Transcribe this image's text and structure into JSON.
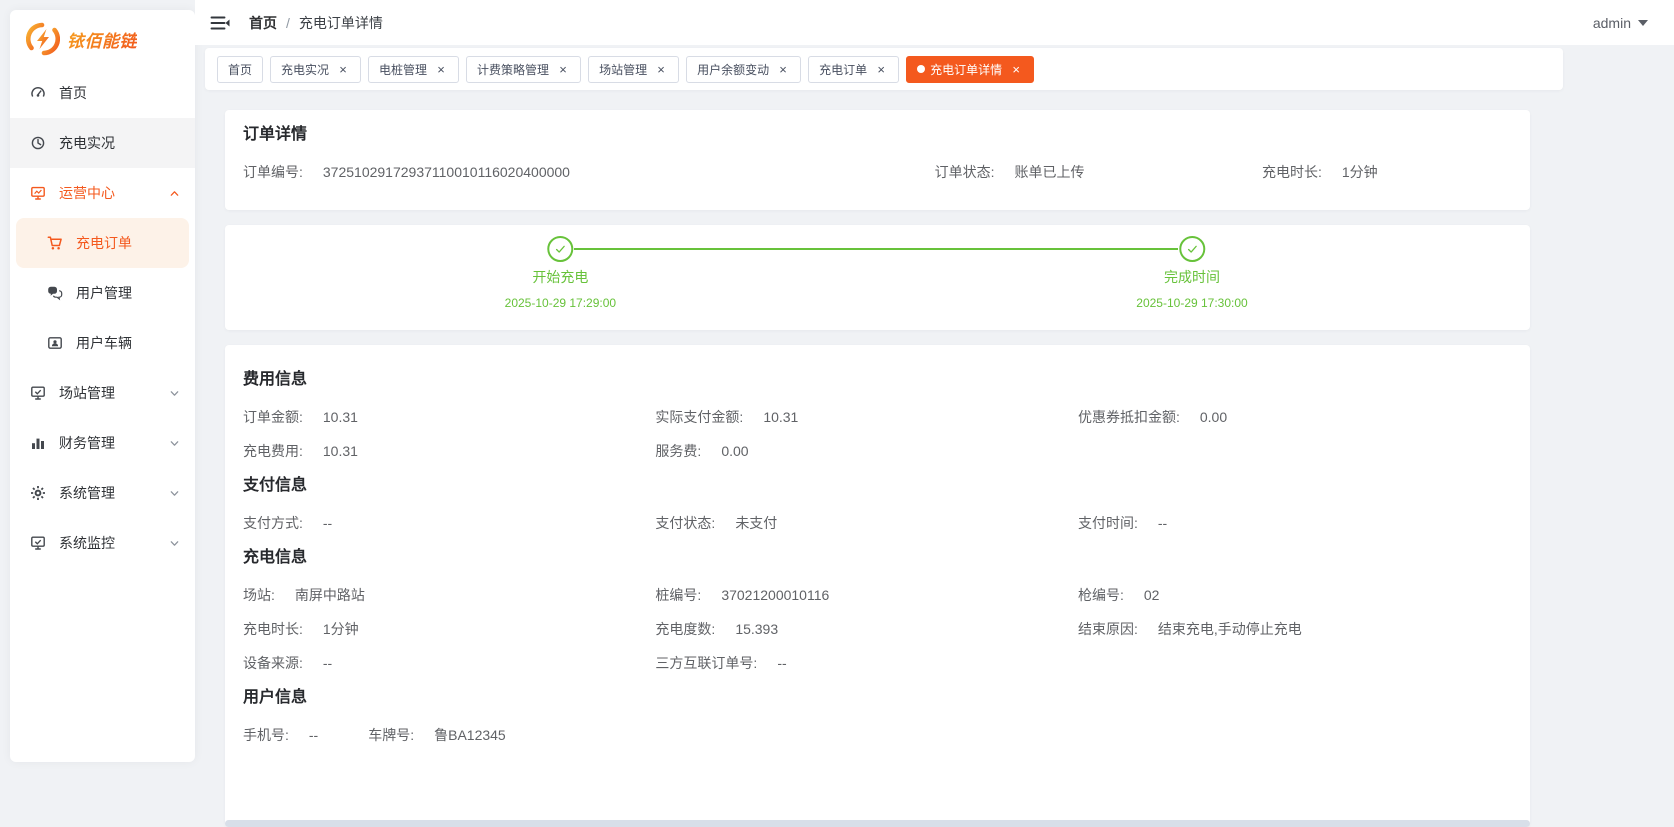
{
  "colors": {
    "accent": "#f4591e",
    "accent-light-bg": "#fdf2e8",
    "success": "#67c23a",
    "page-bg": "#f0f2f5"
  },
  "brand": {
    "name": "铱佰能链"
  },
  "header": {
    "breadcrumb": {
      "root": "首页",
      "separator": "/",
      "current": "充电订单详情"
    },
    "user": "admin"
  },
  "sidebar": {
    "items": [
      {
        "id": "home",
        "label": "首页",
        "icon": "dashboard-icon"
      },
      {
        "id": "charging-live",
        "label": "充电实况",
        "icon": "live-status-icon",
        "shaded": true
      },
      {
        "id": "operations-center",
        "label": "运营中心",
        "icon": "operations-icon",
        "collapsible": true,
        "expanded": true,
        "children": [
          {
            "id": "charging-orders",
            "label": "充电订单",
            "icon": "cart-icon",
            "active": true
          },
          {
            "id": "user-management",
            "label": "用户管理",
            "icon": "users-chat-icon"
          },
          {
            "id": "user-vehicles",
            "label": "用户车辆",
            "icon": "vehicle-card-icon"
          }
        ]
      },
      {
        "id": "station-management",
        "label": "场站管理",
        "icon": "station-monitor-icon",
        "collapsible": true
      },
      {
        "id": "finance-management",
        "label": "财务管理",
        "icon": "bar-chart-icon",
        "collapsible": true
      },
      {
        "id": "system-management",
        "label": "系统管理",
        "icon": "gear-icon",
        "collapsible": true
      },
      {
        "id": "system-monitoring",
        "label": "系统监控",
        "icon": "monitor-check-icon",
        "collapsible": true
      }
    ]
  },
  "tabs": [
    {
      "id": "home",
      "label": "首页",
      "closable": false
    },
    {
      "id": "charging-live",
      "label": "充电实况",
      "closable": true
    },
    {
      "id": "pile-management",
      "label": "电桩管理",
      "closable": true
    },
    {
      "id": "billing-strategy",
      "label": "计费策略管理",
      "closable": true
    },
    {
      "id": "station-management",
      "label": "场站管理",
      "closable": true
    },
    {
      "id": "balance-changes",
      "label": "用户余额变动",
      "closable": true
    },
    {
      "id": "charging-orders",
      "label": "充电订单",
      "closable": true
    },
    {
      "id": "order-detail",
      "label": "充电订单详情",
      "closable": true,
      "active": true
    }
  ],
  "order_card": {
    "title": "订单详情",
    "fields": [
      {
        "label": "订单编号:",
        "value": "37251029172937110010116020400000"
      },
      {
        "label": "订单状态:",
        "value": "账单已上传"
      },
      {
        "label": "充电时长:",
        "value": "1分钟"
      }
    ]
  },
  "timeline": {
    "steps": [
      {
        "title": "开始充电",
        "time": "2025-10-29 17:29:00"
      },
      {
        "title": "完成时间",
        "time": "2025-10-29 17:30:00"
      }
    ]
  },
  "detail_sections": [
    {
      "title": "费用信息",
      "layout": "grid",
      "rows": [
        [
          {
            "label": "订单金额:",
            "value": "10.31"
          },
          {
            "label": "实际支付金额:",
            "value": "10.31"
          },
          {
            "label": "优惠券抵扣金额:",
            "value": "0.00"
          }
        ],
        [
          {
            "label": "充电费用:",
            "value": "10.31"
          },
          {
            "label": "服务费:",
            "value": "0.00"
          }
        ]
      ]
    },
    {
      "title": "支付信息",
      "layout": "grid",
      "rows": [
        [
          {
            "label": "支付方式:",
            "value": "--"
          },
          {
            "label": "支付状态:",
            "value": "未支付"
          },
          {
            "label": "支付时间:",
            "value": "--"
          }
        ]
      ]
    },
    {
      "title": "充电信息",
      "layout": "grid",
      "rows": [
        [
          {
            "label": "场站:",
            "value": "南屏中路站"
          },
          {
            "label": "桩编号:",
            "value": "37021200010116"
          },
          {
            "label": "枪编号:",
            "value": "02"
          }
        ],
        [
          {
            "label": "充电时长:",
            "value": "1分钟"
          },
          {
            "label": "充电度数:",
            "value": "15.393"
          },
          {
            "label": "结束原因:",
            "value": "结束充电,手动停止充电"
          }
        ],
        [
          {
            "label": "设备来源:",
            "value": "--"
          },
          {
            "label": "三方互联订单号:",
            "value": "--"
          }
        ]
      ]
    },
    {
      "title": "用户信息",
      "layout": "inline",
      "rows": [
        [
          {
            "label": "手机号:",
            "value": "--"
          },
          {
            "label": "车牌号:",
            "value": "鲁BA12345"
          }
        ]
      ]
    }
  ]
}
